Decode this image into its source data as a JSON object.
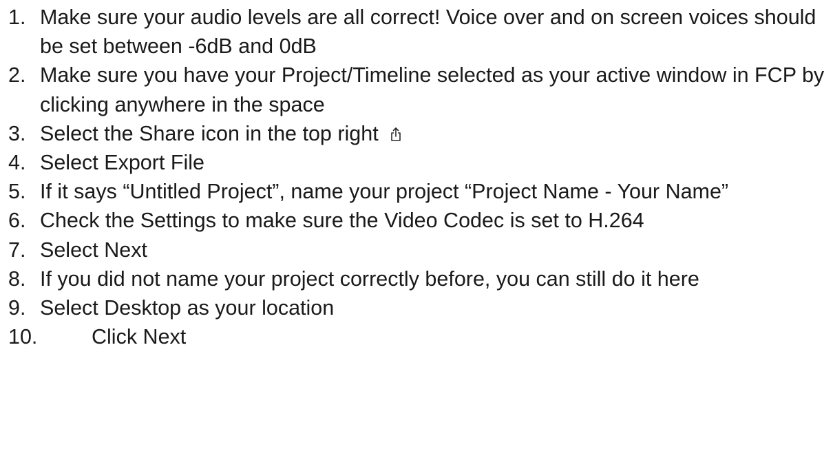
{
  "steps": [
    {
      "num": "1.",
      "text": "Make sure your audio levels are all correct! Voice over and on screen voices should be set between -6dB and 0dB"
    },
    {
      "num": "2.",
      "text": "Make sure you have your Project/Timeline selected as your active window in FCP by clicking anywhere in the space"
    },
    {
      "num": "3.",
      "text": "Select the Share icon in the top right",
      "icon": "share-icon"
    },
    {
      "num": "4.",
      "text": "Select Export File"
    },
    {
      "num": "5.",
      "text": "If it says “Untitled Project”, name your project “Project Name - Your Name”"
    },
    {
      "num": "6.",
      "text": "Check the Settings to make sure the Video Codec is set to H.264"
    },
    {
      "num": "7.",
      "text": "Select Next"
    },
    {
      "num": "8.",
      "text": "If you did not name your project correctly before, you can still do it here"
    },
    {
      "num": "9.",
      "text": "Select Desktop as your location"
    },
    {
      "num": "10.",
      "text": "Click Next"
    }
  ]
}
